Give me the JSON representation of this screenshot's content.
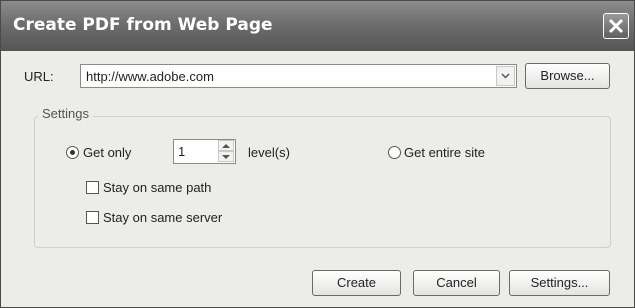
{
  "window": {
    "title": "Create PDF from Web Page"
  },
  "url": {
    "label": "URL:",
    "value": "http://www.adobe.com"
  },
  "browse_label": "Browse...",
  "settings": {
    "legend": "Settings",
    "get_only_label": "Get only",
    "levels_value": "1",
    "levels_unit": "level(s)",
    "get_entire_site_label": "Get entire site",
    "selected_option": "Get only",
    "stay_same_path_label": "Stay on same path",
    "stay_same_path_checked": false,
    "stay_same_server_label": "Stay on same server",
    "stay_same_server_checked": false
  },
  "buttons": {
    "create": "Create",
    "cancel": "Cancel",
    "settings": "Settings..."
  },
  "icons": {
    "close": "close-icon",
    "dropdown": "chevron-down-icon",
    "spin_up": "spin-up-icon",
    "spin_down": "spin-down-icon"
  },
  "colors": {
    "titlebar": "#6e6e6e",
    "dialog_bg": "#ecece9"
  }
}
